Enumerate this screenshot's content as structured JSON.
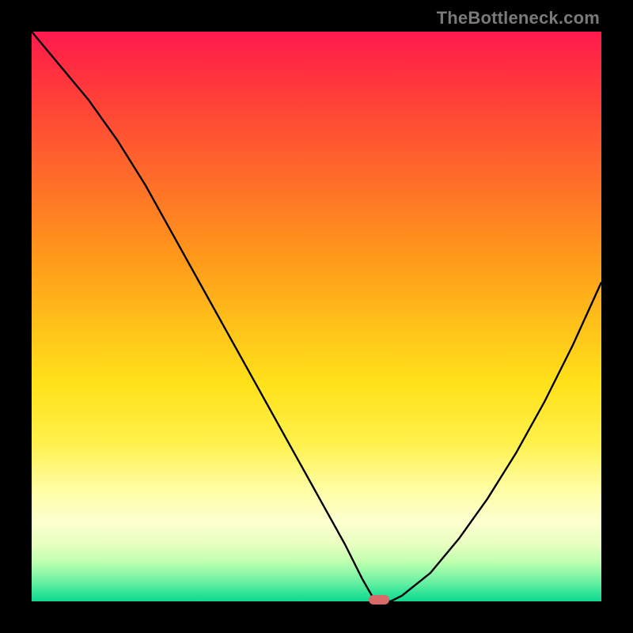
{
  "watermark": "TheBottleneck.com",
  "chart_data": {
    "type": "line",
    "title": "",
    "xlabel": "",
    "ylabel": "",
    "xlim": [
      0,
      100
    ],
    "ylim": [
      0,
      100
    ],
    "grid": false,
    "legend": false,
    "x": [
      0,
      5,
      10,
      15,
      20,
      25,
      30,
      35,
      40,
      45,
      50,
      55,
      58,
      60,
      63,
      65,
      70,
      75,
      80,
      85,
      90,
      95,
      100
    ],
    "y": [
      100,
      94,
      88,
      81,
      73,
      64,
      55,
      46,
      37,
      28,
      19,
      10,
      4,
      0.5,
      0,
      1,
      5,
      11,
      18,
      26,
      35,
      45,
      56
    ],
    "valley_x_range": [
      58,
      63
    ],
    "marker": {
      "x": 61,
      "y": 0.3
    }
  },
  "colors": {
    "curve": "#000000",
    "marker": "#d86a6a"
  }
}
